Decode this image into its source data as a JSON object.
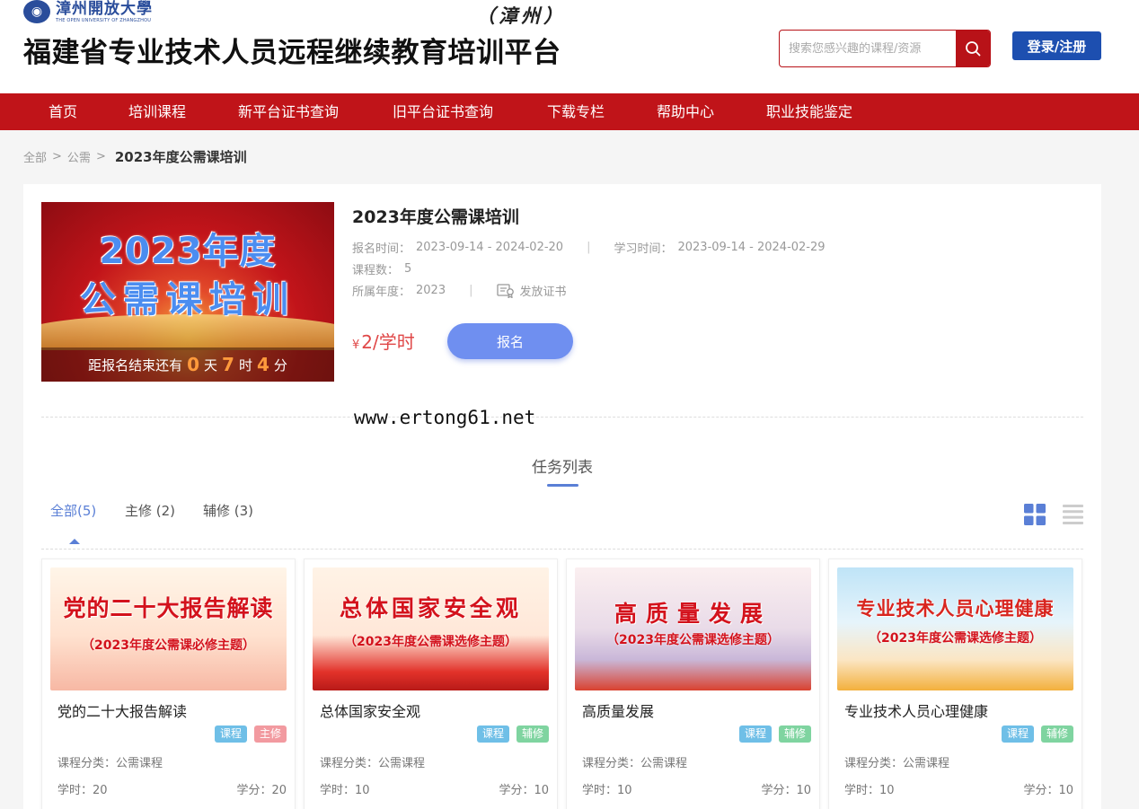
{
  "header": {
    "logo_cn": "漳州開放大學",
    "logo_en": "THE OPEN UNIVERSITY OF ZHANGZHOU",
    "site_title": "福建省专业技术人员远程继续教育培训平台",
    "site_subtitle": "（漳州）",
    "search_placeholder": "搜索您感兴趣的课程/资源",
    "login_label": "登录/注册",
    "accent_color": "#c01419",
    "login_color": "#1d4fb0"
  },
  "nav": {
    "items": [
      "首页",
      "培训课程",
      "新平台证书查询",
      "旧平台证书查询",
      "下载专栏",
      "帮助中心",
      "职业技能鉴定"
    ]
  },
  "breadcrumb": {
    "items": [
      "全部",
      "公需"
    ],
    "separator": ">",
    "current": "2023年度公需课培训"
  },
  "course": {
    "banner_line1": "2023年度",
    "banner_line2": "公需课培训",
    "countdown_prefix": "距报名结束还有",
    "countdown_days": "0",
    "countdown_days_unit": "天",
    "countdown_hours": "7",
    "countdown_hours_unit": "时",
    "countdown_minutes": "4",
    "countdown_minutes_unit": "分",
    "title": "2023年度公需课培训",
    "signup_label": "报名时间：",
    "signup_time": "2023-09-14 - 2024-02-20",
    "study_label": "学习时间：",
    "study_time": "2023-09-14 - 2024-02-29",
    "course_count_label": "课程数：",
    "course_count": "5",
    "year_label": "所属年度：",
    "year": "2023",
    "certificate_label": "发放证书",
    "divider": "|",
    "price_symbol": "¥",
    "price": "2/学时",
    "enroll_label": "报名"
  },
  "watermark": "www.ertong61.net",
  "tasks": {
    "section_title": "任务列表",
    "tabs": [
      "全部(5)",
      "主修 (2)",
      "辅修 (3)"
    ],
    "active_tab": 0
  },
  "cards": [
    {
      "img_title": "党的二十大报告解读",
      "img_subtitle": "（2023年度公需课必修主题）",
      "title": "党的二十大报告解读",
      "badges": [
        "课程",
        "主修"
      ],
      "category": "课程分类：公需课程",
      "hours": "学时：20",
      "credits": "学分：20"
    },
    {
      "img_title": "总体国家安全观",
      "img_subtitle": "（2023年度公需课选修主题）",
      "title": "总体国家安全观",
      "badges": [
        "课程",
        "辅修"
      ],
      "category": "课程分类：公需课程",
      "hours": "学时：10",
      "credits": "学分：10"
    },
    {
      "img_title": "高质量发展",
      "img_subtitle": "（2023年度公需课选修主题）",
      "title": "高质量发展",
      "badges": [
        "课程",
        "辅修"
      ],
      "category": "课程分类：公需课程",
      "hours": "学时：10",
      "credits": "学分：10"
    },
    {
      "img_title": "专业技术人员心理健康",
      "img_subtitle": "（2023年度公需课选修主题）",
      "title": "专业技术人员心理健康",
      "badges": [
        "课程",
        "辅修"
      ],
      "category": "课程分类：公需课程",
      "hours": "学时：10",
      "credits": "学分：10"
    }
  ]
}
